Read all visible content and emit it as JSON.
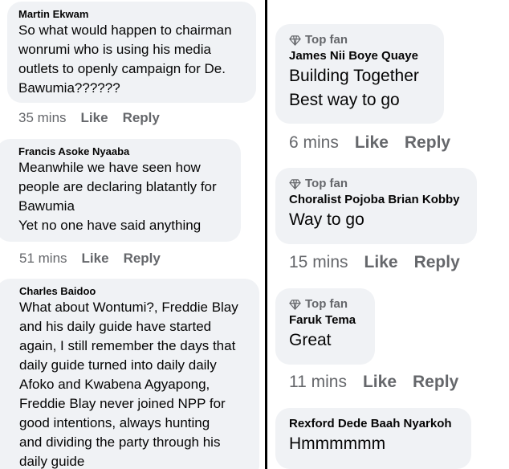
{
  "left": {
    "comments": [
      {
        "author": "Martin Ekwam",
        "text": "So what would happen to chairman\nwonrumi who is using his media\noutlets to openly campaign for De.\nBawumia??????",
        "time": "35 mins",
        "like": "Like",
        "reply": "Reply"
      },
      {
        "author": "Francis Asoke Nyaaba",
        "text": "Meanwhile we  have seen how\npeople are declaring blatantly for\nBawumia\nYet no one have said anything",
        "time": "51 mins",
        "like": "Like",
        "reply": "Reply"
      },
      {
        "author": "Charles Baidoo",
        "text": "What about Wontumi?, Freddie Blay\nand his daily guide have started\nagain, I still remember the days that\ndaily guide turned into daily daily\nAfoko and Kwabena Agyapong,\nFreddie Blay never joined NPP for\ngood intentions, always hunting\nand dividing the party through his\ndaily guide"
      }
    ]
  },
  "right": {
    "comments": [
      {
        "badge": "Top fan",
        "author": "James Nii Boye Quaye",
        "text": "Building Together\nBest way to go",
        "time": "6 mins",
        "like": "Like",
        "reply": "Reply"
      },
      {
        "badge": "Top fan",
        "author": "Choralist Pojoba Brian Kobby",
        "text": "Way to go",
        "time": "15 mins",
        "like": "Like",
        "reply": "Reply"
      },
      {
        "badge": "Top fan",
        "author": "Faruk Tema",
        "text": "Great",
        "time": "11 mins",
        "like": "Like",
        "reply": "Reply"
      },
      {
        "author": "Rexford Dede Baah Nyarkoh",
        "text": "Hmmmmmm"
      }
    ]
  }
}
